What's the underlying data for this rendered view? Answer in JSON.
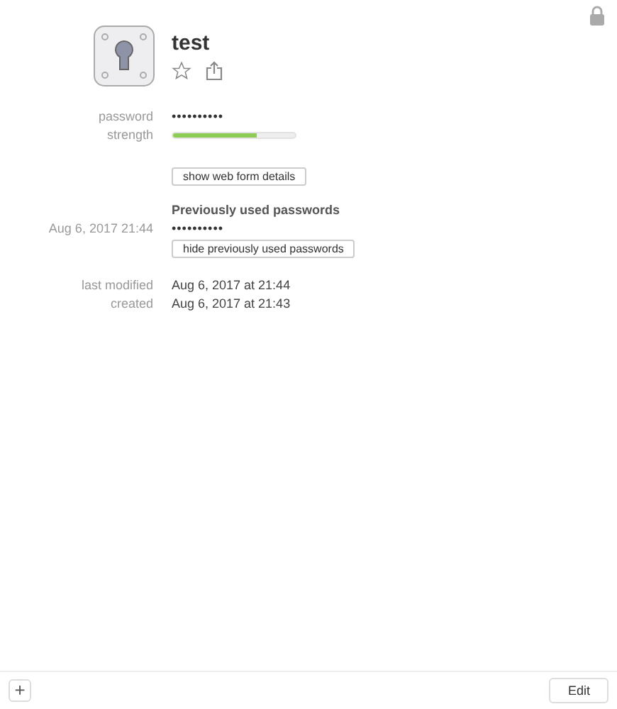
{
  "item": {
    "title": "test",
    "favorite": false
  },
  "fields": [
    {
      "kind": "password",
      "label": "password",
      "value": "••••••••••"
    },
    {
      "kind": "meter",
      "label": "strength",
      "level": 0.69
    }
  ],
  "web_form_button": "show web form details",
  "previous_passwords": {
    "heading": "Previously used passwords",
    "entries": [
      {
        "date": "Aug 6, 2017 21:44",
        "value": "••••••••••"
      }
    ],
    "toggle_button": "hide previously used passwords"
  },
  "dates": [
    {
      "label": "last modified",
      "value": "Aug 6, 2017 at 21:44"
    },
    {
      "label": "created",
      "value": "Aug 6, 2017 at 21:43"
    }
  ],
  "footer": {
    "add_button": "+",
    "edit_button": "Edit"
  }
}
